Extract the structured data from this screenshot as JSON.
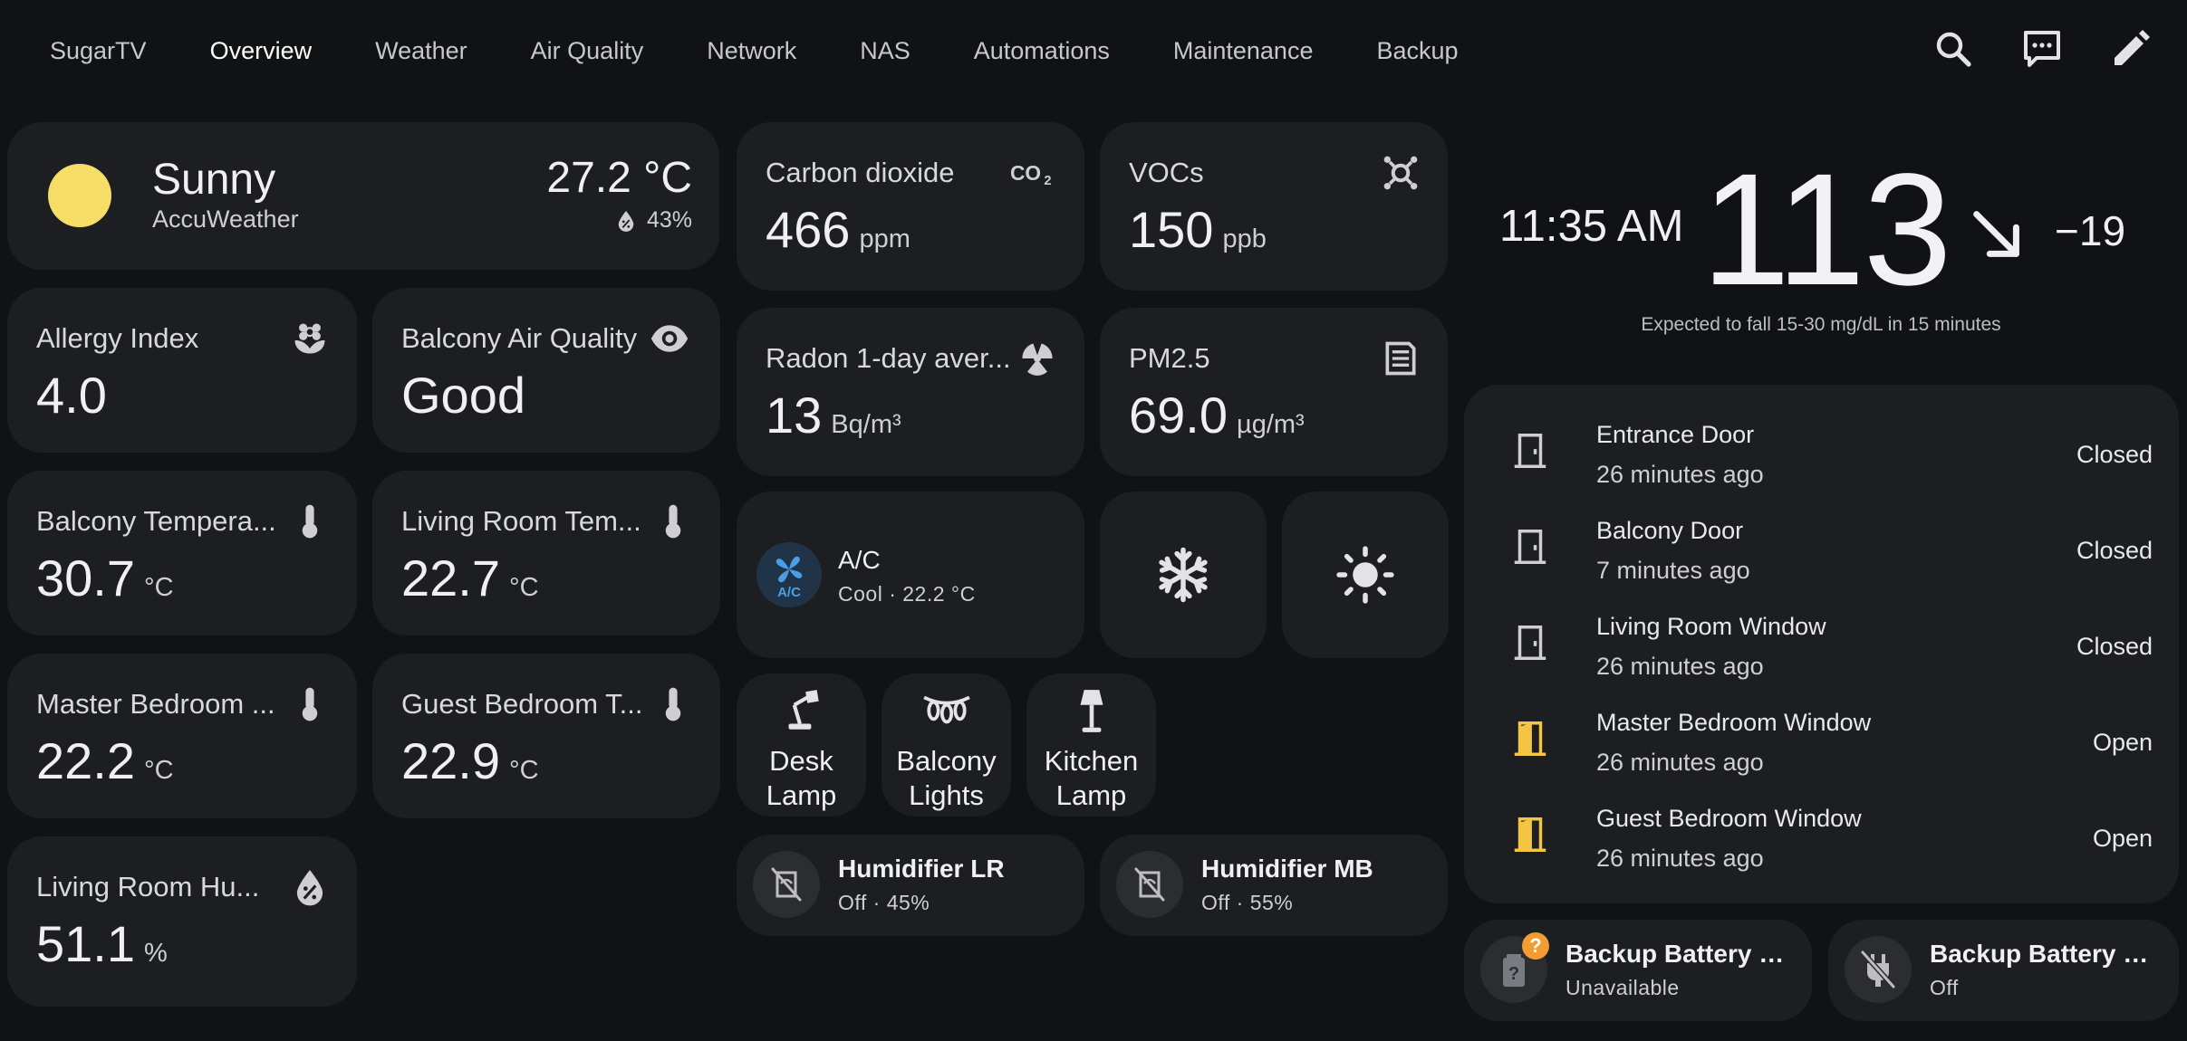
{
  "nav": {
    "tabs": [
      "SugarTV",
      "Overview",
      "Weather",
      "Air Quality",
      "Network",
      "NAS",
      "Automations",
      "Maintenance",
      "Backup"
    ],
    "active_tab": "Overview",
    "icons": [
      "search-icon",
      "assist-chat-icon",
      "edit-pencil-icon"
    ]
  },
  "weather": {
    "condition": "Sunny",
    "source": "AccuWeather",
    "temperature": "27.2 °C",
    "humidity": "43%",
    "sun_color": "#f6dd67"
  },
  "sensors": {
    "allergy": {
      "label": "Allergy Index",
      "value": "4.0",
      "unit": ""
    },
    "balcony_aq": {
      "label": "Balcony Air Quality",
      "value": "Good",
      "unit": ""
    },
    "balcony_temp": {
      "label": "Balcony Tempera...",
      "value": "30.7",
      "unit": "°C"
    },
    "living_temp": {
      "label": "Living Room Tem...",
      "value": "22.7",
      "unit": "°C"
    },
    "master_temp": {
      "label": "Master Bedroom ...",
      "value": "22.2",
      "unit": "°C"
    },
    "guest_temp": {
      "label": "Guest Bedroom T...",
      "value": "22.9",
      "unit": "°C"
    },
    "living_hum": {
      "label": "Living Room Hu...",
      "value": "51.1",
      "unit": "%"
    },
    "co2": {
      "label": "Carbon dioxide",
      "value": "466",
      "unit": "ppm"
    },
    "vocs": {
      "label": "VOCs",
      "value": "150",
      "unit": "ppb"
    },
    "radon": {
      "label": "Radon 1-day aver...",
      "value": "13",
      "unit": "Bq/m³"
    },
    "pm25": {
      "label": "PM2.5",
      "value": "69.0",
      "unit": "µg/m³"
    }
  },
  "climate": {
    "name": "A/C",
    "state": "Cool · 22.2 °C",
    "badge_color": "#213447",
    "icon_color": "#4a9ee8",
    "buttons": [
      "snowflake-icon",
      "sun-icon"
    ]
  },
  "lights": [
    {
      "name_1": "Desk",
      "name_2": "Lamp",
      "icon": "desk-lamp-icon"
    },
    {
      "name_1": "Balcony",
      "name_2": "Lights",
      "icon": "string-lights-icon"
    },
    {
      "name_1": "Kitchen",
      "name_2": "Lamp",
      "icon": "floor-lamp-icon"
    }
  ],
  "humidifiers": [
    {
      "name": "Humidifier LR",
      "state": "Off · 45%"
    },
    {
      "name": "Humidifier MB",
      "state": "Off · 55%"
    }
  ],
  "glucose": {
    "time": "11:35 AM",
    "value": "113",
    "trend": "arrow-down-right-icon",
    "delta": "−19",
    "note": "Expected to fall 15-30 mg/dL in 15 minutes"
  },
  "entities": [
    {
      "name": "Entrance Door",
      "time": "26 minutes ago",
      "state": "Closed",
      "open": false
    },
    {
      "name": "Balcony Door",
      "time": "7 minutes ago",
      "state": "Closed",
      "open": false
    },
    {
      "name": "Living Room Window",
      "time": "26 minutes ago",
      "state": "Closed",
      "open": false
    },
    {
      "name": "Master Bedroom Window",
      "time": "26 minutes ago",
      "state": "Open",
      "open": true
    },
    {
      "name": "Guest Bedroom Window",
      "time": "26 minutes ago",
      "state": "Open",
      "open": true
    }
  ],
  "backup": [
    {
      "name": "Backup Battery Pe...",
      "state": "Unavailable",
      "badge": "?"
    },
    {
      "name": "Backup Battery Pl...",
      "state": "Off"
    }
  ],
  "colors": {
    "background": "#111214",
    "card": "#1d1e21",
    "open_accent": "#f4c542",
    "warning_badge": "#f39c32"
  }
}
